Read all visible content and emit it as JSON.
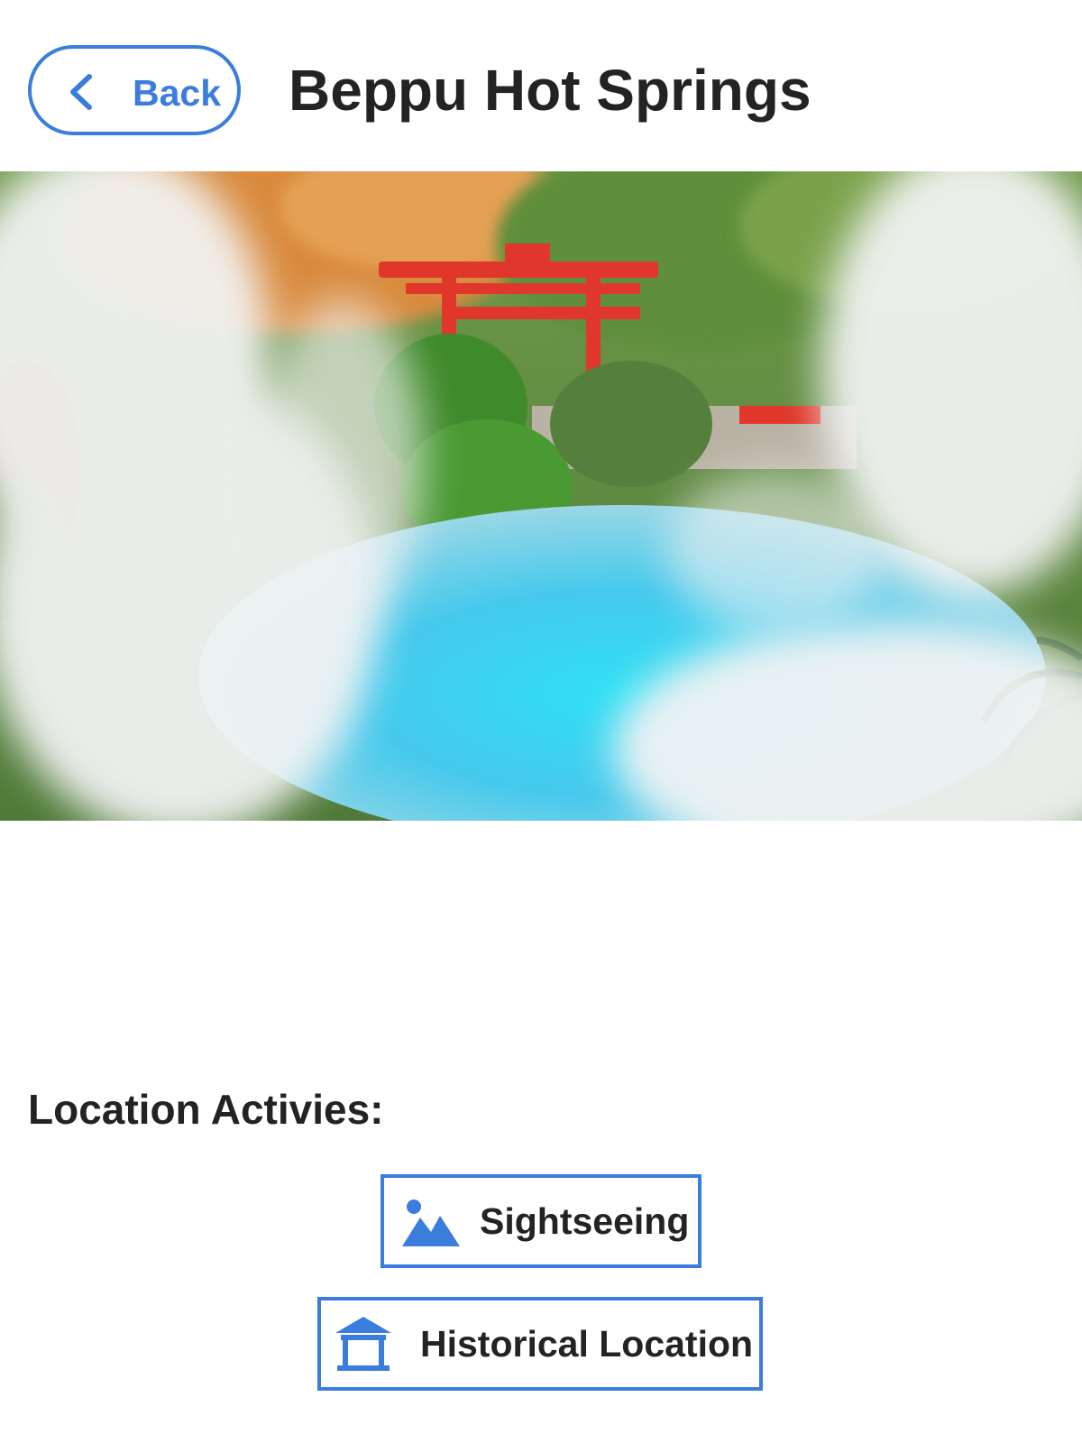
{
  "header": {
    "back_label": "Back",
    "title": "Beppu Hot Springs"
  },
  "hero": {
    "alt": "Steaming blue hot spring pool with a red torii gate and autumn foliage"
  },
  "activities": {
    "heading": "Location Activies:",
    "items": [
      {
        "label": "Sightseeing",
        "icon": "mountain-landscape-icon"
      },
      {
        "label": "Historical Location",
        "icon": "pagoda-shrine-icon"
      }
    ]
  },
  "colors": {
    "accent": "#3b7ddd",
    "text": "#232323",
    "background": "#ffffff"
  }
}
